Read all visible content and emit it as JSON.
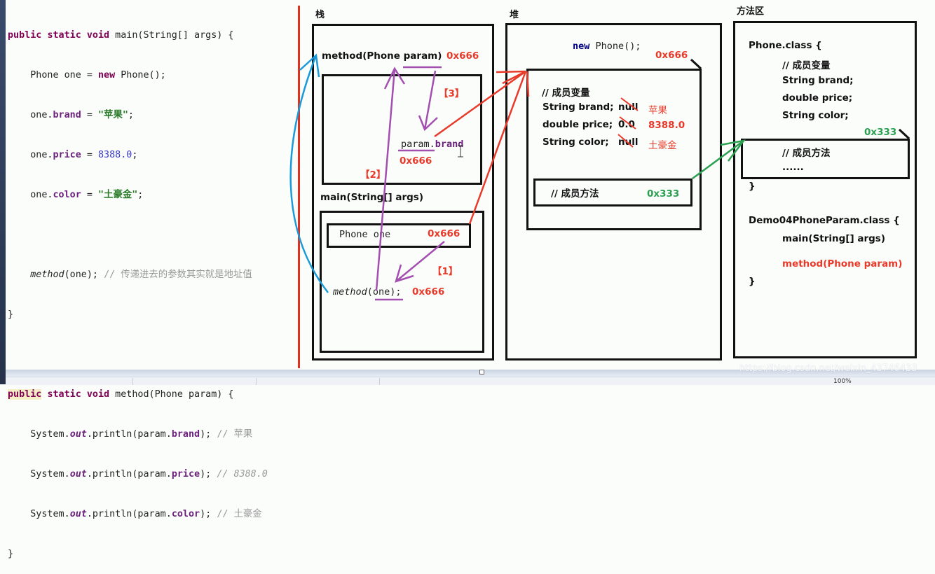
{
  "code": {
    "lines": [
      [
        "public",
        " ",
        "static",
        " ",
        "void",
        " main(String[] args) {"
      ],
      [
        "    Phone one = ",
        "new",
        " Phone();"
      ],
      [
        "    one.",
        "brand",
        " = ",
        "\"苹果\"",
        ";"
      ],
      [
        "    one.",
        "price",
        " = ",
        "8388.0",
        ";"
      ],
      [
        "    one.",
        "color",
        " = ",
        "\"土豪金\"",
        ";"
      ],
      [
        ""
      ],
      [
        "    ",
        "method",
        "(one); ",
        "// 传递进去的参数其实就是地址值"
      ],
      [
        "}"
      ],
      [
        ""
      ],
      [
        "public",
        " ",
        "static",
        " ",
        "void",
        " method(Phone param) {"
      ],
      [
        "    System.",
        "out",
        ".println(param.",
        "brand",
        "); ",
        "// 苹果"
      ],
      [
        "    System.",
        "out",
        ".println(param.",
        "price",
        "); ",
        "// 8388.0"
      ],
      [
        "    System.",
        "out",
        ".println(param.",
        "color",
        "); ",
        "// 土豪金"
      ],
      [
        "}"
      ]
    ]
  },
  "regions": {
    "stack": "栈",
    "heap": "堆",
    "method_area": "方法区"
  },
  "stack": {
    "method_frame_label": "method(Phone param)",
    "method_frame_addr": "0x666",
    "param_brand": [
      "param",
      ".",
      "brand"
    ],
    "param_addr": "0x666",
    "main_frame_label": "main(String[] args)",
    "phone_one_label": "Phone  one",
    "phone_one_addr": "0x666",
    "method_call": [
      "method",
      "(one)",
      ";"
    ],
    "method_call_addr": "0x666",
    "steps": [
      "【1】",
      "【2】",
      "【3】"
    ]
  },
  "heap": {
    "new_expr": [
      "new",
      " Phone();"
    ],
    "object_addr": "0x666",
    "member_vars_comment": "// 成员变量",
    "fields": [
      {
        "decl": "String brand;",
        "default": "null",
        "value": "苹果"
      },
      {
        "decl": "double price;",
        "default": "0.0",
        "value": "8388.0"
      },
      {
        "decl": "String color;",
        "default": "null",
        "value": "土豪金"
      }
    ],
    "member_methods_comment": "// 成员方法",
    "methods_addr": "0x333"
  },
  "method_area": {
    "phone_class_header": "Phone.class {",
    "member_vars_comment": "// 成员变量",
    "fields": [
      "String brand;",
      "double price;",
      "String color;"
    ],
    "methods_addr": "0x333",
    "member_methods_comment": "// 成员方法",
    "ellipsis": "......",
    "close_brace": "}",
    "demo_class_header": "Demo04PhoneParam.class {",
    "demo_methods": [
      "main(String[] args)",
      "method(Phone param)"
    ],
    "demo_close_brace": "}"
  },
  "watermark": "https://blog.csdn.net/weixin_43746433",
  "status": {
    "zoom": "100%"
  },
  "colors": {
    "red": "#e83a2a",
    "green": "#2aa050",
    "purple": "#a34fb0",
    "blue": "#1a9ad8"
  }
}
